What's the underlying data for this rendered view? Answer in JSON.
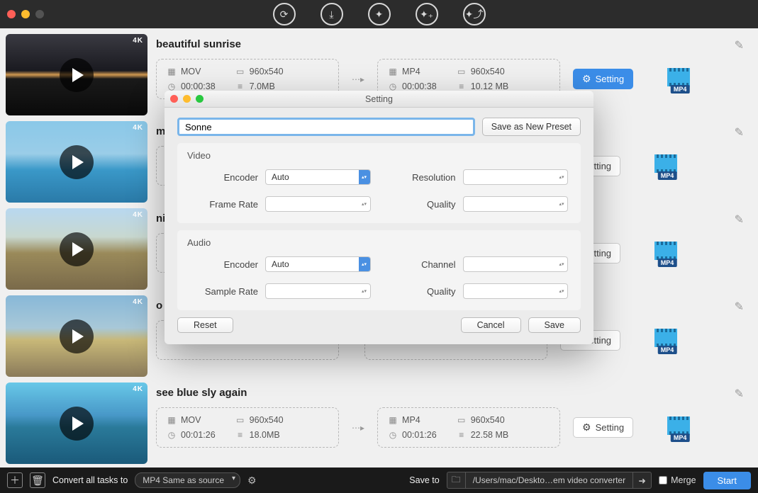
{
  "titlebar": {
    "close": "close",
    "min": "minimize",
    "max": "maximize"
  },
  "videos": [
    {
      "title": "beautiful sunrise",
      "src": {
        "fmt": "MOV",
        "res": "960x540",
        "dur": "00:00:38",
        "size": "7.0MB"
      },
      "dst": {
        "fmt": "MP4",
        "res": "960x540",
        "dur": "00:00:38",
        "size": "10.12 MB"
      },
      "settingActive": true,
      "badge": "MP4",
      "k4": "4K"
    },
    {
      "title": "m",
      "src": {
        "fmt": "",
        "res": "",
        "dur": "",
        "size": ""
      },
      "dst": {
        "fmt": "",
        "res": "",
        "dur": "",
        "size": ""
      },
      "settingActive": false,
      "badge": "MP4",
      "k4": "4K"
    },
    {
      "title": "ni",
      "src": {
        "fmt": "",
        "res": "",
        "dur": "",
        "size": ""
      },
      "dst": {
        "fmt": "",
        "res": "",
        "dur": "",
        "size": ""
      },
      "settingActive": false,
      "badge": "MP4",
      "k4": "4K"
    },
    {
      "title": "o",
      "src": {
        "fmt": "",
        "res": "",
        "dur": "",
        "size": ""
      },
      "dst": {
        "fmt": "",
        "res": "",
        "dur": "",
        "size": ""
      },
      "settingActive": false,
      "badge": "MP4",
      "k4": "4K"
    },
    {
      "title": "see blue sly again",
      "src": {
        "fmt": "MOV",
        "res": "960x540",
        "dur": "00:01:26",
        "size": "18.0MB"
      },
      "dst": {
        "fmt": "MP4",
        "res": "960x540",
        "dur": "00:01:26",
        "size": "22.58 MB"
      },
      "settingActive": false,
      "badge": "MP4",
      "k4": "4K"
    }
  ],
  "row_labels": {
    "setting": "Setting"
  },
  "bottom": {
    "convert_label": "Convert all tasks to",
    "convert_value": "MP4 Same as source",
    "save_to": "Save to",
    "path": "/Users/mac/Deskto…em video converter",
    "merge": "Merge",
    "start": "Start"
  },
  "modal": {
    "title": "Setting",
    "preset_value": "Sonne",
    "save_preset": "Save as New Preset",
    "video_section": "Video",
    "audio_section": "Audio",
    "labels": {
      "encoder": "Encoder",
      "resolution": "Resolution",
      "frame_rate": "Frame Rate",
      "quality": "Quality",
      "sample_rate": "Sample Rate",
      "channel": "Channel"
    },
    "values": {
      "video_encoder": "Auto",
      "video_resolution": "",
      "video_frame_rate": "",
      "video_quality": "",
      "audio_encoder": "Auto",
      "audio_channel": "",
      "audio_sample_rate": "",
      "audio_quality": ""
    },
    "buttons": {
      "reset": "Reset",
      "cancel": "Cancel",
      "save": "Save"
    }
  }
}
